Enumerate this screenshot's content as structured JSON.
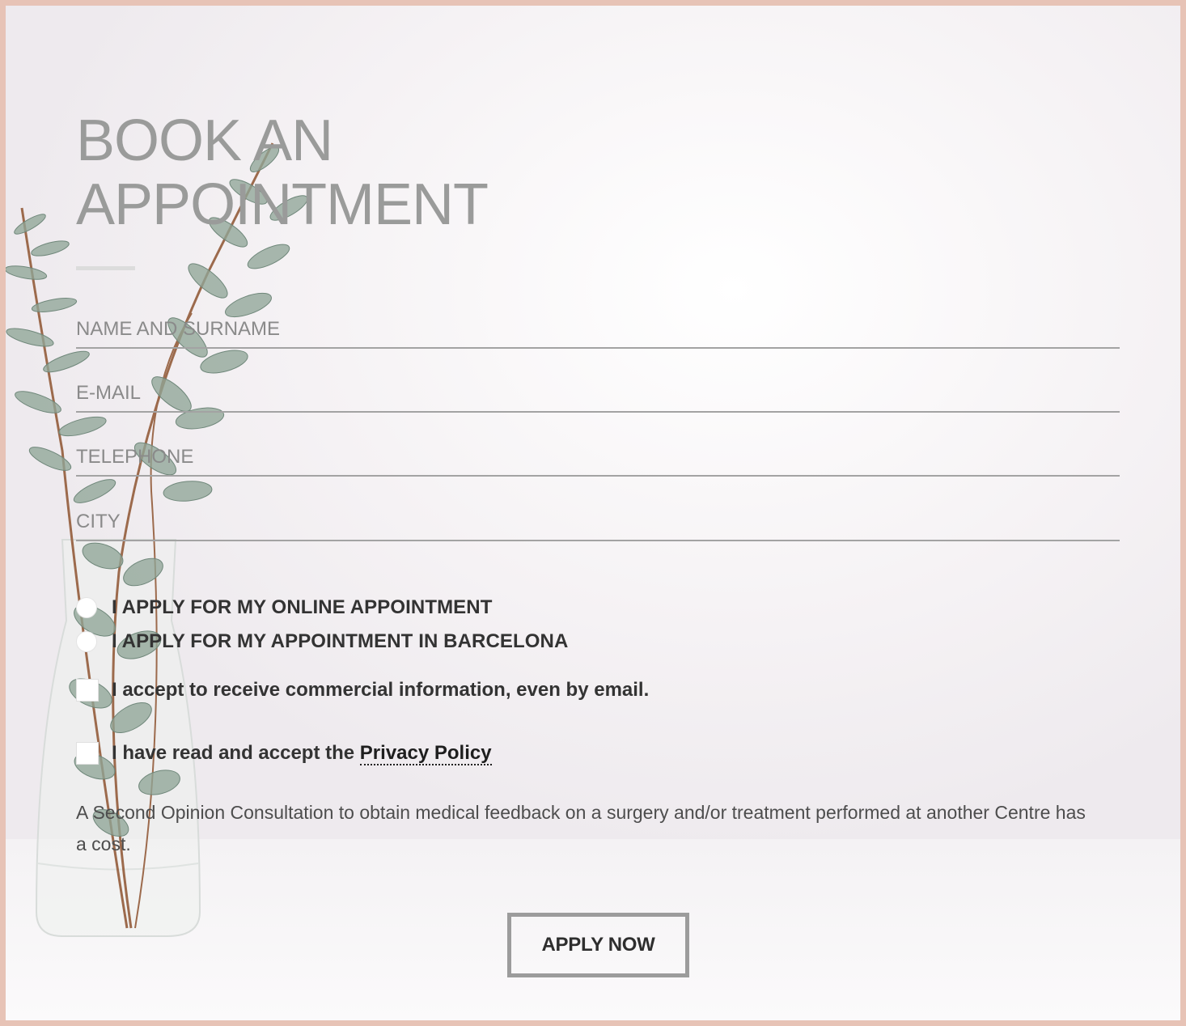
{
  "form": {
    "title_line1": "BOOK AN",
    "title_line2": "APPOINTMENT",
    "fields": {
      "name_placeholder": "NAME AND SURNAME",
      "email_placeholder": "E-MAIL",
      "telephone_placeholder": "TELEPHONE",
      "city_placeholder": "CITY"
    },
    "options": {
      "online": "I APPLY FOR MY ONLINE APPOINTMENT",
      "barcelona": "I APPLY FOR MY APPOINTMENT IN BARCELONA"
    },
    "consents": {
      "commercial": "I accept to receive commercial information, even by email.",
      "privacy_prefix": "I have read and accept the ",
      "privacy_link": "Privacy Policy"
    },
    "note": "A Second Opinion Consultation to obtain medical feedback on a surgery and/or treatment performed at another Centre has a cost.",
    "submit_label": "APPLY NOW"
  },
  "colors": {
    "frame_border": "#e7c3b6",
    "title": "#9a9b9a",
    "button_border": "#9c9c9c"
  }
}
